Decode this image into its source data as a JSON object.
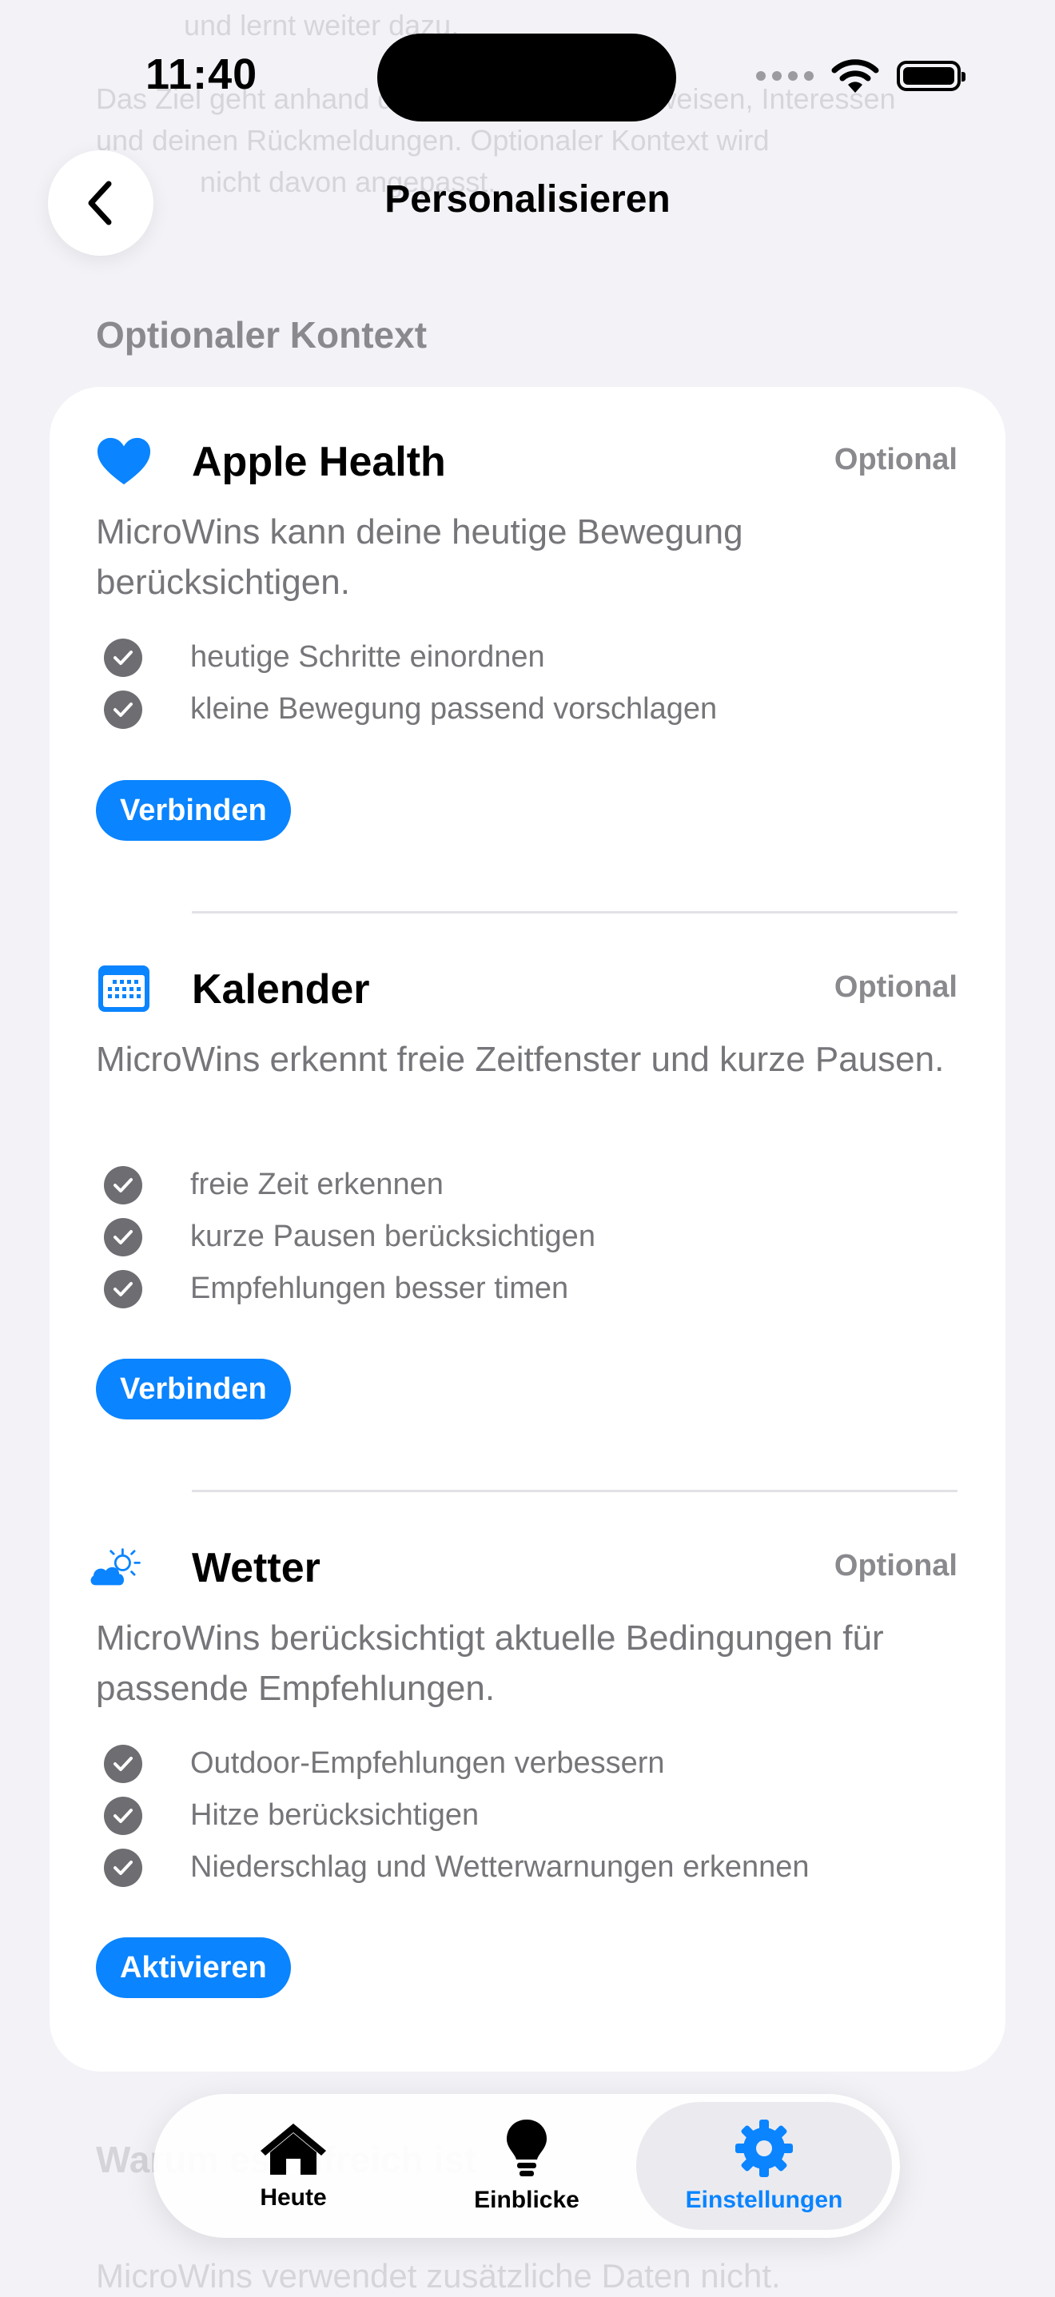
{
  "background_text": {
    "top_line_1": "und lernt weiter dazu.",
    "top_line_2": "Das Ziel geht anhand deiner Aktivitäten, Hinweisen, Interessen",
    "top_line_3": "und deinen Rückmeldungen. Optionaler Kontext wird",
    "top_line_4": "nicht davon angepasst.",
    "bottom_heading": "Warum es hilfreich ist",
    "bottom_body": "MicroWins verwendet zusätzliche Daten nicht."
  },
  "status_bar": {
    "time": "11:40"
  },
  "nav": {
    "title": "Personalisieren",
    "back_icon": "chevron-left-icon"
  },
  "section": {
    "header": "Optionaler Kontext"
  },
  "integrations": [
    {
      "title": "Apple Health",
      "badge": "Optional",
      "icon": "heart-icon",
      "description": "MicroWins kann deine heutige Bewegung berücksichtigen.",
      "features": [
        "heutige Schritte einordnen",
        "kleine Bewegung passend vorschlagen"
      ],
      "action": "Verbinden"
    },
    {
      "title": "Kalender",
      "badge": "Optional",
      "icon": "calendar-icon",
      "description": "MicroWins erkennt freie Zeitfenster und kurze Pausen.",
      "features": [
        "freie Zeit erkennen",
        "kurze Pausen berücksichtigen",
        "Empfehlungen besser timen"
      ],
      "action": "Verbinden"
    },
    {
      "title": "Wetter",
      "badge": "Optional",
      "icon": "weather-icon",
      "description": "MicroWins berücksichtigt aktuelle Bedingungen für passende Empfehlungen.",
      "features": [
        "Outdoor-Empfehlungen verbessern",
        "Hitze berücksichtigen",
        "Niederschlag und Wetterwarnungen erkennen"
      ],
      "action": "Aktivieren"
    }
  ],
  "tab_bar": {
    "items": [
      {
        "label": "Heute",
        "icon": "house-icon",
        "active": false
      },
      {
        "label": "Einblicke",
        "icon": "lightbulb-icon",
        "active": false
      },
      {
        "label": "Einstellungen",
        "icon": "gear-icon",
        "active": true
      }
    ]
  },
  "colors": {
    "accent": "#0a84ff",
    "secondary_text": "#76767a",
    "background": "#f2f2f7"
  }
}
